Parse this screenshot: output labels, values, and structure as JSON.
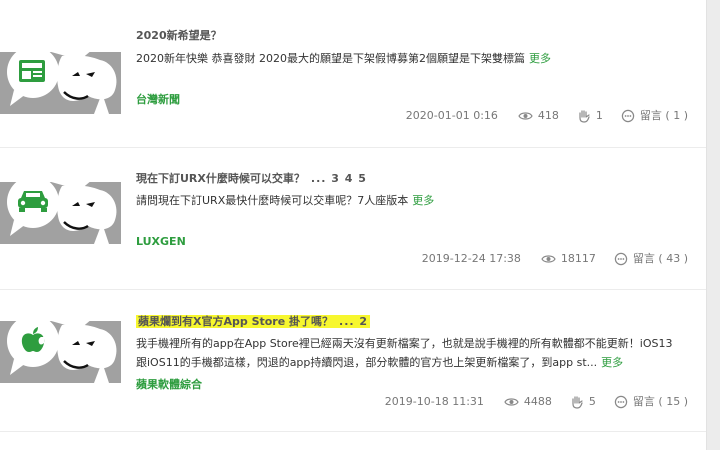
{
  "posts": [
    {
      "title": "2020新希望是？",
      "excerpt": "2020新年快樂 恭喜發財 2020最大的願望是下架假博募第2個願望是下架雙標篇",
      "more": "更多",
      "board": "台灣新聞",
      "date": "2020-01-01 0:16",
      "views": "418",
      "likes": "1",
      "comments": "留言 ( 1 )",
      "icon": "news-icon"
    },
    {
      "title": "現在下訂URX什麼時候可以交車？",
      "pages": "... 3 4 5",
      "excerpt": "請問現在下訂URX最快什麼時候可以交車呢？7人座版本",
      "more": "更多",
      "board": "LUXGEN",
      "date": "2019-12-24 17:38",
      "views": "18117",
      "comments": "留言 ( 43 )",
      "icon": "car-icon"
    },
    {
      "title": "蘋果爛到有X官方App Store 掛了嗎？",
      "pages": "... 2",
      "excerpt": "我手機裡所有的app在App Store裡已經兩天沒有更新檔案了，也就是說手機裡的所有軟體都不能更新！iOS13 跟iOS11的手機都這樣，閃退的app持續閃退，部分軟體的官方也上架更新檔案了，到app st...",
      "more": "更多",
      "board": "蘋果軟體綜合",
      "date": "2019-10-18 11:31",
      "views": "4488",
      "likes": "5",
      "comments": "留言 ( 15 )",
      "icon": "apple-icon",
      "highlight_color": "#f7f72e"
    }
  ],
  "colors": {
    "accent": "#2e9d3f",
    "thumb_bg": "#a1a1a1",
    "highlight": "#f7f72e"
  }
}
